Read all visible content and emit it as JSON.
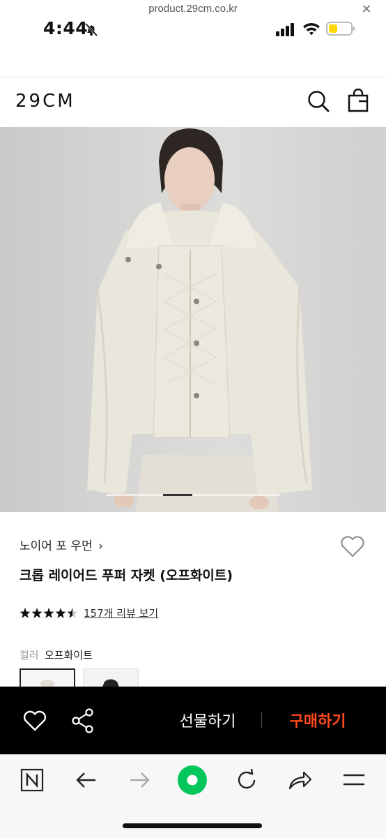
{
  "status_bar": {
    "time": "4:44"
  },
  "url_bar": {
    "url": "product.29cm.co.kr",
    "close_glyph": "✕"
  },
  "header": {
    "logo": "29CM"
  },
  "product": {
    "brand": "노이어 포 우먼",
    "brand_chevron": "›",
    "title": "크롭 레이어드 푸퍼 자켓 (오프화이트)",
    "rating": 4.5,
    "review_link": "157개 리뷰 보기",
    "color_label": "컬러",
    "color_value": "오프화이트"
  },
  "action_bar": {
    "gift_label": "선물하기",
    "buy_label": "구매하기"
  },
  "colors": {
    "buy_accent": "#ff4a1c",
    "naver_green": "#03c75a",
    "battery_yellow": "#ffd60a"
  },
  "icons": [
    "bell-slash-icon",
    "signal-icon",
    "wifi-icon",
    "battery-icon",
    "search-icon",
    "cart-icon",
    "heart-icon",
    "share-icon",
    "naver-n-icon",
    "back-arrow-icon",
    "forward-arrow-icon",
    "green-circle-icon",
    "reload-icon",
    "share-arrow-icon",
    "menu-icon"
  ]
}
